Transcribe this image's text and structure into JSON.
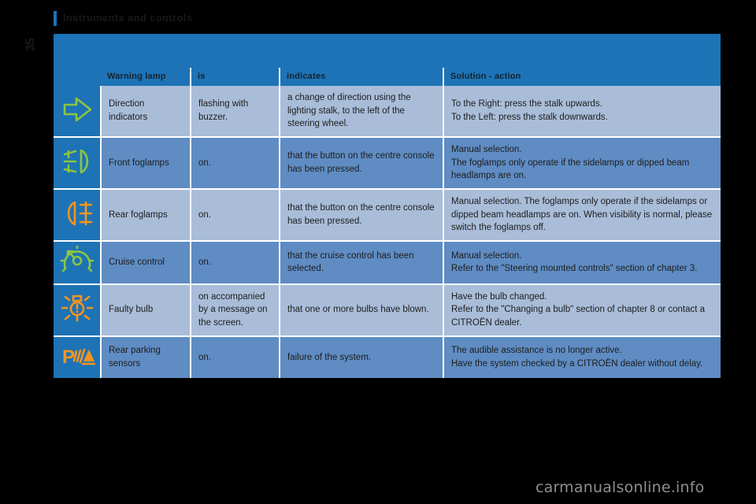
{
  "document": {
    "chapter_title": "Instruments and controls",
    "page_number": "35",
    "watermark": "carmanualsonline.info"
  },
  "colors": {
    "brand_blue": "#1d73b5",
    "row_light": "#a9bdd9",
    "row_dark": "#5f8cc3",
    "icon_green": "#8cc63f",
    "icon_orange": "#f7941e",
    "page_background": "#000000"
  },
  "table": {
    "headers": [
      "",
      "Warning lamp",
      "is",
      "indicates",
      "Solution - action"
    ],
    "rows": [
      {
        "icon": "direction-indicator-arrow-icon",
        "icon_color": "#8cc63f",
        "lamp": "Direction indicators",
        "is": "flashing with buzzer.",
        "indicates": "a change of direction using the lighting stalk, to the left of the steering wheel.",
        "solution": [
          "To the Right: press the stalk upwards.",
          "To the Left: press the stalk downwards."
        ]
      },
      {
        "icon": "front-foglamp-icon",
        "icon_color": "#8cc63f",
        "lamp": "Front foglamps",
        "is": "on.",
        "indicates": "that the button on the centre console has been pressed.",
        "solution": [
          "Manual selection.",
          "The foglamps only operate if the sidelamps or dipped beam headlamps are on."
        ]
      },
      {
        "icon": "rear-foglamp-icon",
        "icon_color": "#f7941e",
        "lamp": "Rear foglamps",
        "is": "on.",
        "indicates": "that the button on the centre console has been pressed.",
        "solution": [
          "Manual selection. The foglamps only operate if the sidelamps or dipped beam headlamps are on. When visibility is normal, please switch the foglamps off."
        ]
      },
      {
        "icon": "cruise-control-icon",
        "icon_color": "#8cc63f",
        "lamp": "Cruise control",
        "is": "on.",
        "indicates": "that the cruise control has been selected.",
        "solution": [
          "Manual selection.",
          "Refer to the \"Steering mounted controls\" section of chapter 3."
        ]
      },
      {
        "icon": "faulty-bulb-icon",
        "icon_color": "#f7941e",
        "lamp": "Faulty bulb",
        "is": "on accompanied by a message on the screen.",
        "indicates": "that one or more bulbs have blown.",
        "solution": [
          "Have the bulb changed.",
          "Refer to the \"Changing a bulb\" section of chapter 8 or contact a CITROËN dealer."
        ]
      },
      {
        "icon": "rear-parking-sensor-icon",
        "icon_color": "#f7941e",
        "lamp": "Rear parking sensors",
        "is": "on.",
        "indicates": "failure of the system.",
        "solution": [
          "The audible assistance is no longer active.",
          "Have the system checked by a CITROËN dealer without delay."
        ]
      }
    ]
  }
}
